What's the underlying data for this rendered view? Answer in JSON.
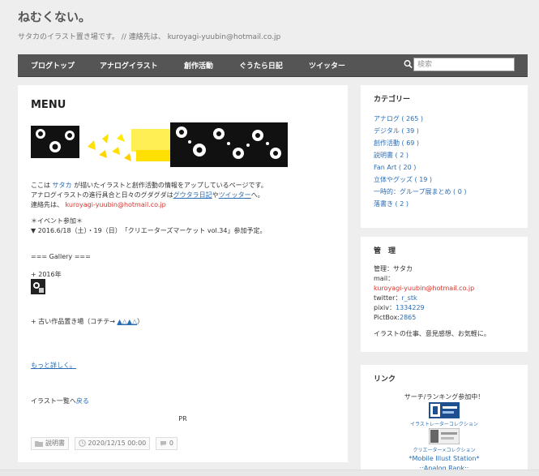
{
  "site": {
    "title": "ねむくない。",
    "description": "サタカのイラスト置き場です。 // 連絡先は、 kuroyagi-yuubin@hotmail.co.jp"
  },
  "nav": {
    "items": [
      "ブログトップ",
      "アナログイラスト",
      "創作活動",
      "ぐうたら日記",
      "ツイッター"
    ],
    "search_placeholder": "検索"
  },
  "post": {
    "title": "MENU",
    "intro1_a": "ここは ",
    "intro1_name": "サタカ",
    "intro1_b": " が描いたイラストと創作活動の情報をアップしているページです。",
    "intro2_a": "アナログイラストの進行具合と日々のグダグダは",
    "intro2_link1": "グウタラ日記",
    "intro2_b": "や",
    "intro2_link2": "ツイッター",
    "intro2_c": "へ。",
    "contact_label": "連絡先は、",
    "contact_email": "kuroyagi-yuubin@hotmail.co.jp",
    "event_heading": "＊イベント参加＊",
    "event_line": "▼ 2016.6/18（土）・19（日）　「クリエーターズマーケット vol.34」参加予定。",
    "gallery_heading": "=== Gallery ===",
    "year_2016": "+ 2016年",
    "old_works_a": "+ 古い作品置き場（コチテ→ ",
    "old_works_link": "▲△▲△",
    "old_works_b": "）",
    "more_link": "もっと詳しく。",
    "list_back_a": "イラスト一覧へ",
    "list_back_link": "戻る",
    "pr": "PR",
    "meta": {
      "category": "説明書",
      "date": "2020/12/15 00:00",
      "comments": "0"
    }
  },
  "sidebar": {
    "categories": {
      "title": "カテゴリー",
      "items": [
        "アナログ ( 265 )",
        "デジタル ( 39 )",
        "創作活動 ( 69 )",
        "説明書 ( 2 )",
        "Fan Art ( 20 )",
        "立体やグッズ ( 19 )",
        "一時的：グループ展まとめ ( 0 )",
        "落書き ( 2 )"
      ]
    },
    "admin": {
      "title": "管　理",
      "name": "管理：サタカ",
      "mail_label": "mail：",
      "mail": "kuroyagi-yuubin@hotmail.co.jp",
      "twitter_label": "twitter：",
      "twitter": "r_stk",
      "pixiv_label": "pixiv：",
      "pixiv": "1334229",
      "pictbox_label": "PictBox:",
      "pictbox": "2865",
      "note": "イラストの仕事、意見感想、お気軽に。"
    },
    "links": {
      "title": "リンク",
      "heading": "サーチ/ランキング参加中！",
      "badge1_label": "イラストレーターコレクション",
      "badge2_label": "クリエーター×コレクション",
      "station": "*Mobile Illust Station*",
      "analog_rank": "::Analog Rank::"
    }
  },
  "colors": {
    "nav_bg": "#555555",
    "link": "#2a6db5",
    "email": "#d9332b",
    "page_bg": "#eeeeee"
  },
  "icons": {
    "search": "search-icon",
    "category": "folder-icon",
    "date": "clock-icon",
    "comments": "comment-icon"
  }
}
